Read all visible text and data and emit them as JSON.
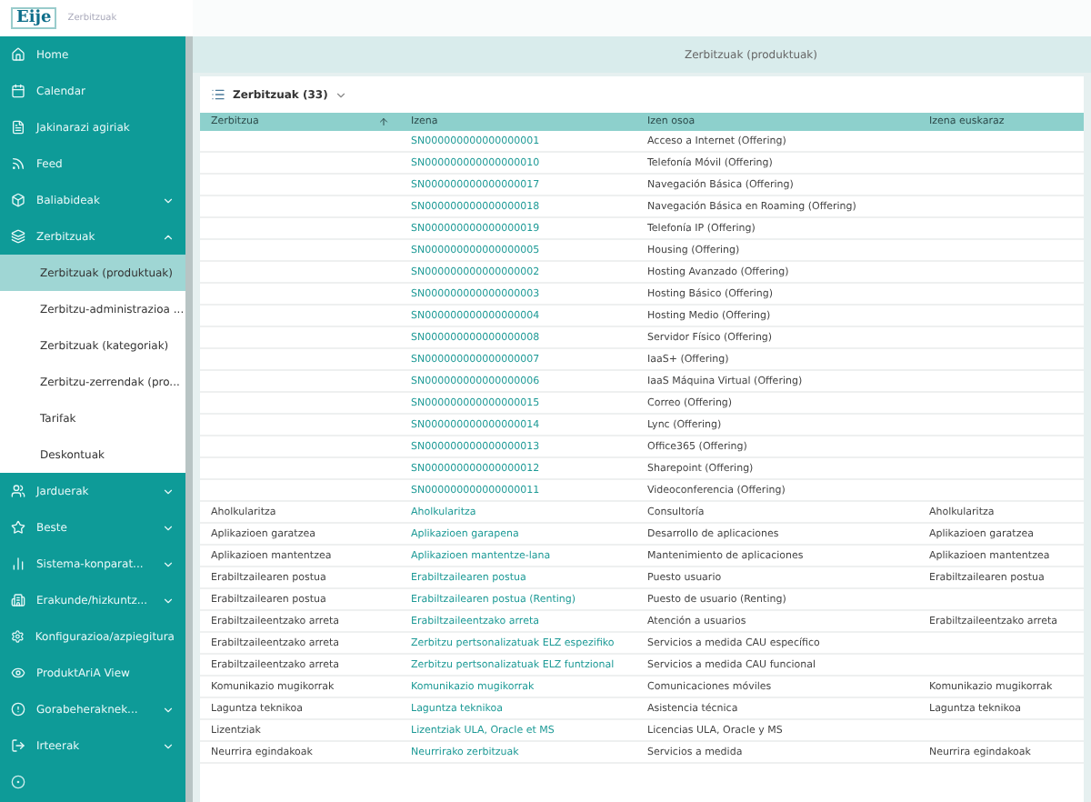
{
  "app": {
    "logo": "Eije",
    "subtitle": "Zerbitzuak"
  },
  "sidebar": {
    "items": [
      {
        "label": "Home"
      },
      {
        "label": "Calendar"
      },
      {
        "label": "Jakinarazi agiriak"
      },
      {
        "label": "Feed"
      },
      {
        "label": "Baliabideak",
        "expanded": false
      },
      {
        "label": "Zerbitzuak",
        "expanded": true,
        "children": [
          {
            "label": "Zerbitzuak (produktuak)",
            "selected": true
          },
          {
            "label": "Zerbitzu-administrazioa ...",
            "selected": false
          },
          {
            "label": "Zerbitzuak (kategoriak)",
            "selected": false
          },
          {
            "label": "Zerbitzu-zerrendak (pro...",
            "selected": false
          },
          {
            "label": "Tarifak",
            "selected": false
          },
          {
            "label": "Deskontuak",
            "selected": false
          }
        ]
      },
      {
        "label": "Jarduerak",
        "expanded": false
      },
      {
        "label": "Beste",
        "expanded": false
      },
      {
        "label": "Sistema-konparat...",
        "expanded": false
      },
      {
        "label": "Erakunde/hizkuntz...",
        "expanded": false
      },
      {
        "label": "Konfigurazioa/azpiegitura"
      },
      {
        "label": "ProduktAriA View"
      },
      {
        "label": "Gorabeheraknek...",
        "expanded": false
      },
      {
        "label": "Irteerak",
        "expanded": false
      }
    ]
  },
  "page_title": "Zerbitzuak (produktuak)",
  "view": {
    "label": "Zerbitzuak (33)"
  },
  "table": {
    "columns": [
      {
        "label": "Zerbitzua",
        "sorted": true
      },
      {
        "label": "Izena",
        "sorted": false
      },
      {
        "label": "Izen osoa",
        "sorted": false
      },
      {
        "label": "Izena euskaraz",
        "sorted": false
      }
    ],
    "rows": [
      {
        "izena": "SN000000000000000001",
        "izen_osoa": "Acceso a Internet (Offering)"
      },
      {
        "izena": "SN000000000000000010",
        "izen_osoa": "Telefonía Móvil (Offering)"
      },
      {
        "izena": "SN000000000000000017",
        "izen_osoa": "Navegación Básica (Offering)"
      },
      {
        "izena": "SN000000000000000018",
        "izen_osoa": "Navegación Básica en Roaming (Offering)"
      },
      {
        "izena": "SN000000000000000019",
        "izen_osoa": "Telefonía IP (Offering)"
      },
      {
        "izena": "SN000000000000000005",
        "izen_osoa": "Housing (Offering)"
      },
      {
        "izena": "SN000000000000000002",
        "izen_osoa": "Hosting Avanzado (Offering)"
      },
      {
        "izena": "SN000000000000000003",
        "izen_osoa": "Hosting Básico (Offering)"
      },
      {
        "izena": "SN000000000000000004",
        "izen_osoa": "Hosting Medio (Offering)"
      },
      {
        "izena": "SN000000000000000008",
        "izen_osoa": "Servidor Físico (Offering)"
      },
      {
        "izena": "SN000000000000000007",
        "izen_osoa": "IaaS+ (Offering)"
      },
      {
        "izena": "SN000000000000000006",
        "izen_osoa": "IaaS Máquina Virtual (Offering)"
      },
      {
        "izena": "SN000000000000000015",
        "izen_osoa": "Correo (Offering)"
      },
      {
        "izena": "SN000000000000000014",
        "izen_osoa": "Lync (Offering)"
      },
      {
        "izena": "SN000000000000000013",
        "izen_osoa": "Office365 (Offering)"
      },
      {
        "izena": "SN000000000000000012",
        "izen_osoa": "Sharepoint (Offering)"
      },
      {
        "izena": "SN000000000000000011",
        "izen_osoa": "Videoconferencia (Offering)"
      },
      {
        "zerbitzua": "Aholkularitza",
        "izena": "Aholkularitza",
        "izen_osoa": "Consultoría",
        "euskaraz": "Aholkularitza"
      },
      {
        "zerbitzua": "Aplikazioen garatzea",
        "izena": "Aplikazioen garapena",
        "izen_osoa": "Desarrollo de aplicaciones",
        "euskaraz": "Aplikazioen garatzea"
      },
      {
        "zerbitzua": "Aplikazioen mantentzea",
        "izena": "Aplikazioen mantentze-lana",
        "izen_osoa": "Mantenimiento de aplicaciones",
        "euskaraz": "Aplikazioen mantentzea"
      },
      {
        "zerbitzua": "Erabiltzailearen postua",
        "izena": "Erabiltzailearen postua",
        "izen_osoa": "Puesto usuario",
        "euskaraz": "Erabiltzailearen postua"
      },
      {
        "zerbitzua": "Erabiltzailearen postua",
        "izena": "Erabiltzailearen postua (Renting)",
        "izen_osoa": "Puesto de usuario (Renting)"
      },
      {
        "zerbitzua": "Erabiltzaileentzako arreta",
        "izena": "Erabiltzaileentzako arreta",
        "izen_osoa": "Atención a usuarios",
        "euskaraz": "Erabiltzaileentzako arreta"
      },
      {
        "zerbitzua": "Erabiltzaileentzako arreta",
        "izena": "Zerbitzu pertsonalizatuak ELZ espezifiko",
        "izen_osoa": "Servicios a medida CAU específico"
      },
      {
        "zerbitzua": "Erabiltzaileentzako arreta",
        "izena": "Zerbitzu pertsonalizatuak ELZ funtzional",
        "izen_osoa": "Servicios a medida CAU funcional"
      },
      {
        "zerbitzua": "Komunikazio mugikorrak",
        "izena": "Komunikazio mugikorrak",
        "izen_osoa": "Comunicaciones móviles",
        "euskaraz": "Komunikazio mugikorrak"
      },
      {
        "zerbitzua": "Laguntza teknikoa",
        "izena": "Laguntza teknikoa",
        "izen_osoa": "Asistencia técnica",
        "euskaraz": "Laguntza teknikoa"
      },
      {
        "zerbitzua": "Lizentziak",
        "izena": "Lizentziak ULA, Oracle et MS",
        "izen_osoa": "Licencias ULA, Oracle y MS"
      },
      {
        "zerbitzua": "Neurrira egindakoak",
        "izena": "Neurrirako zerbitzuak",
        "izen_osoa": "Servicios a medida",
        "euskaraz": "Neurrira egindakoak"
      }
    ]
  }
}
